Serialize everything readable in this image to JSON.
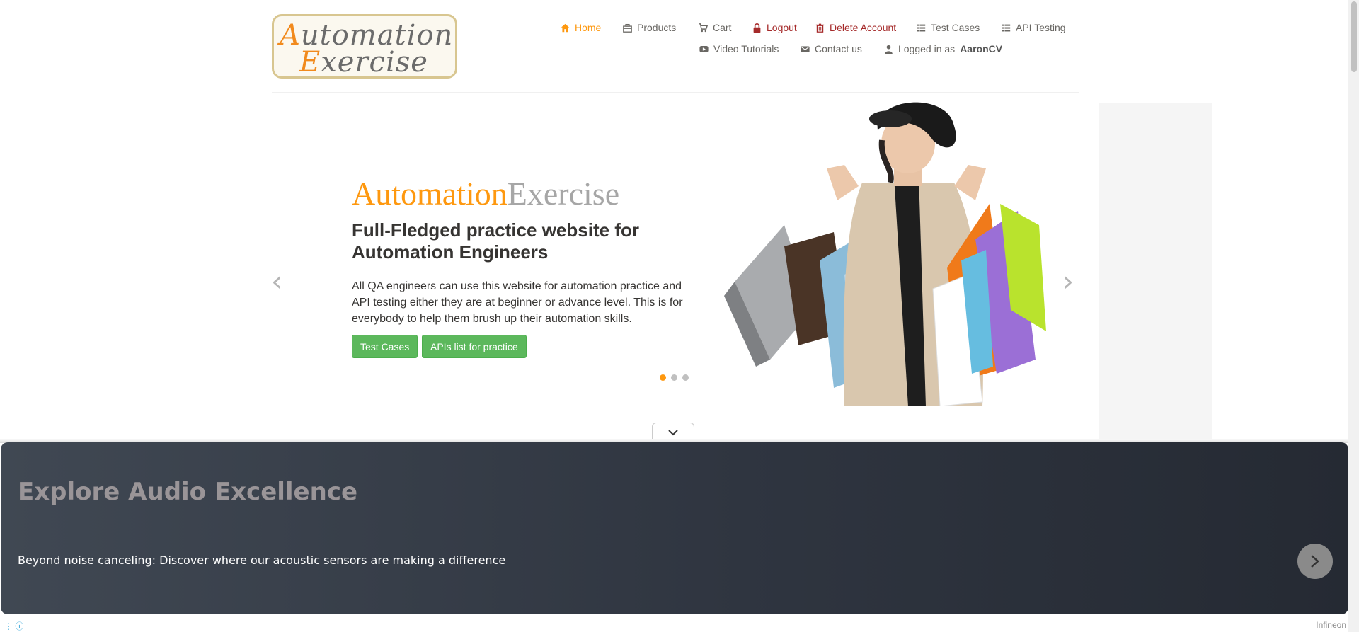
{
  "logo": {
    "line1_cap": "A",
    "line1_rest": "utomation",
    "line2_cap": "E",
    "line2_rest": "xercise"
  },
  "nav": {
    "home": "Home",
    "products": "Products",
    "cart": "Cart",
    "logout": "Logout",
    "delete_account": "Delete Account",
    "test_cases": "Test Cases",
    "api_testing": "API Testing",
    "video_tutorials": "Video Tutorials",
    "contact_us": "Contact us",
    "logged_in_prefix": "Logged in as",
    "username": "AaronCV"
  },
  "slider": {
    "title_part1": "Automation",
    "title_part2": "Exercise",
    "heading": "Full-Fledged practice website for Automation Engineers",
    "paragraph": "All QA engineers can use this website for automation practice and API testing either they are at beginner or advance level. This is for everybody to help them brush up their automation skills.",
    "btn_test_cases": "Test Cases",
    "btn_apis": "APIs list for practice",
    "prev_glyph": "‹",
    "next_glyph": "›",
    "active_dot": 1,
    "dot_count": 3
  },
  "banner": {
    "title": "Explore Audio Excellence",
    "text": "Beyond noise canceling: Discover where our acoustic sensors are making a difference",
    "brand": "Infineon"
  },
  "colors": {
    "accent": "#fe980f",
    "danger": "#a52a2a",
    "button_green": "#5cb85c",
    "banner_bg": "#2f3540"
  }
}
